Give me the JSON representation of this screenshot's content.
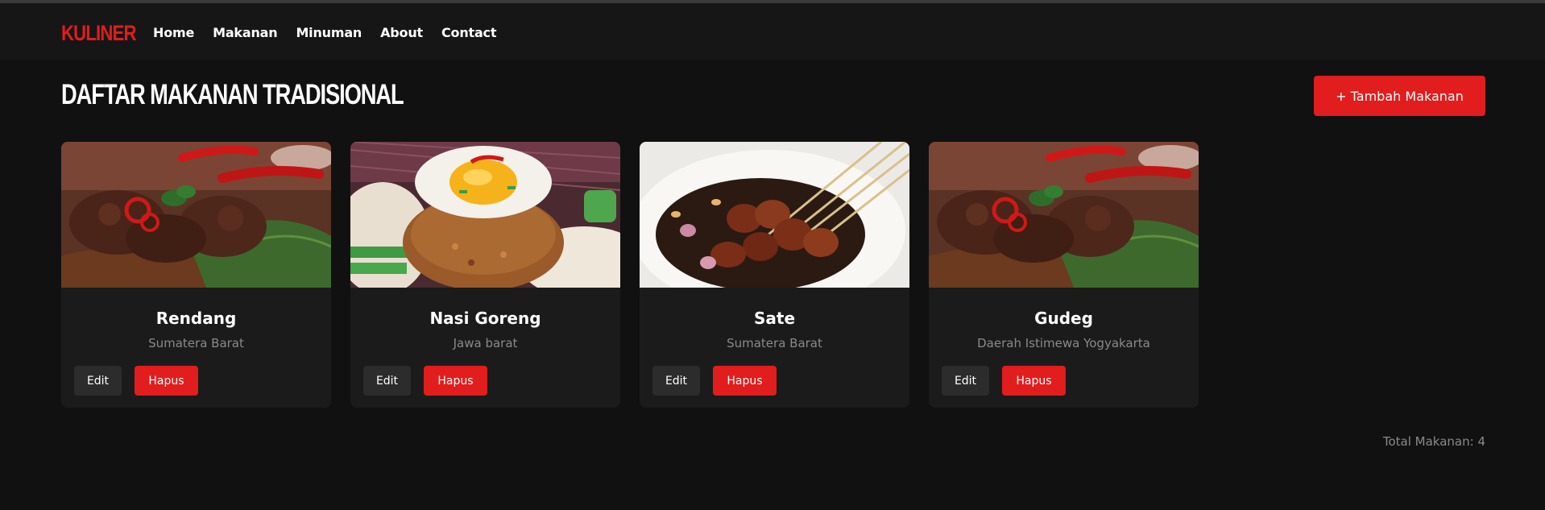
{
  "navbar": {
    "brand": "KULINER",
    "links": [
      "Home",
      "Makanan",
      "Minuman",
      "About",
      "Contact"
    ]
  },
  "header": {
    "title": "DAFTAR MAKANAN TRADISIONAL",
    "add_button": "+ Tambah Makanan"
  },
  "cards": [
    {
      "name": "Rendang",
      "origin": "Sumatera Barat",
      "edit": "Edit",
      "delete": "Hapus",
      "image": "rendang-photo"
    },
    {
      "name": "Nasi Goreng",
      "origin": "Jawa barat",
      "edit": "Edit",
      "delete": "Hapus",
      "image": "nasi-goreng-photo"
    },
    {
      "name": "Sate",
      "origin": "Sumatera Barat",
      "edit": "Edit",
      "delete": "Hapus",
      "image": "sate-photo"
    },
    {
      "name": "Gudeg",
      "origin": "Daerah Istimewa Yogyakarta",
      "edit": "Edit",
      "delete": "Hapus",
      "image": "rendang-photo"
    }
  ],
  "footer": {
    "total": "Total Makanan: 4"
  },
  "colors": {
    "background": "#111111",
    "navbar": "#161616",
    "card": "#1b1b1b",
    "accent": "#e11d1d",
    "muted_text": "#8a8a8a",
    "edit_button": "#2c2c2c"
  }
}
